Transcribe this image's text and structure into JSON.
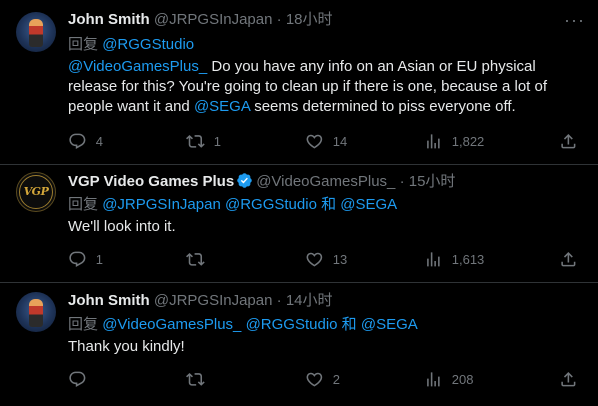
{
  "tweets": [
    {
      "name": "John Smith",
      "handle": "@JRPGSInJapan",
      "sep": "·",
      "time": "18小时",
      "reply_prefix": "回复",
      "reply_to": [
        "@RGGStudio"
      ],
      "body_mention": "@VideoGamesPlus_",
      "body_text_1": " Do you have any info on an Asian or EU physical release for this? You're going to clean up if there is one, because a lot of people want it and ",
      "body_mention_2": "@SEGA",
      "body_text_2": " seems determined to piss everyone off.",
      "replies": "4",
      "retweets": "1",
      "likes": "14",
      "views": "1,822"
    },
    {
      "name": "VGP Video Games Plus",
      "handle": "@VideoGamesPlus_",
      "sep": "·",
      "time": "15小时",
      "reply_prefix": "回复",
      "reply_to": [
        "@JRPGSInJapan",
        "@RGGStudio",
        "@SEGA"
      ],
      "reply_and": "和",
      "body": "We'll look into it.",
      "replies": "1",
      "retweets": "",
      "likes": "13",
      "views": "1,613",
      "verified": true
    },
    {
      "name": "John Smith",
      "handle": "@JRPGSInJapan",
      "sep": "·",
      "time": "14小时",
      "reply_prefix": "回复",
      "reply_to": [
        "@VideoGamesPlus_",
        "@RGGStudio",
        "@SEGA"
      ],
      "reply_and": "和",
      "body": "Thank you kindly!",
      "replies": "",
      "retweets": "",
      "likes": "2",
      "views": "208"
    }
  ],
  "avatar_logo_text": "VGP",
  "more_glyph": "···",
  "colors": {
    "background": "#000000",
    "text": "#e7e9ea",
    "muted": "#71767b",
    "link": "#1d9bf0",
    "divider": "#2f3336"
  },
  "icons": [
    "reply-icon",
    "retweet-icon",
    "like-icon",
    "views-icon",
    "share-icon",
    "more-icon",
    "verified-icon"
  ]
}
